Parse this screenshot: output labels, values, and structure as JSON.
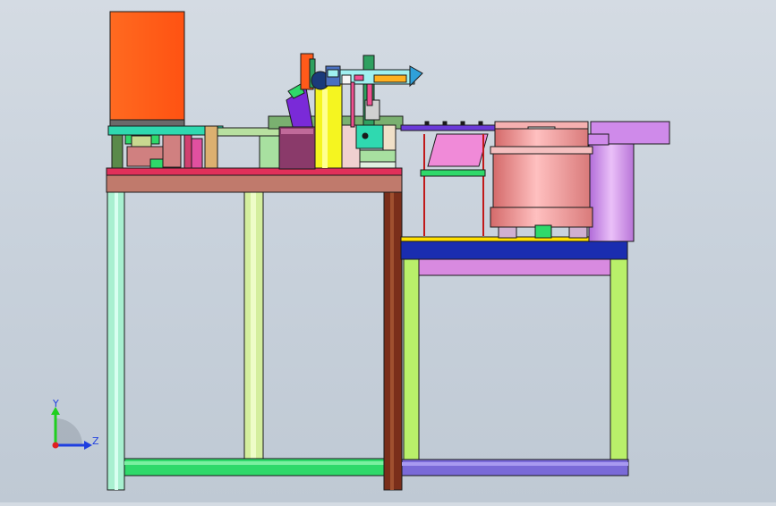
{
  "scene": {
    "background_top": "#d4dbe3",
    "background_bottom": "#bfc9d4",
    "outline_color": "#1a1a1a"
  },
  "triad": {
    "axis_y_label": "Y",
    "axis_z_label": "Z",
    "y_color": "#1fcf1f",
    "z_color": "#1f3fe0",
    "origin_color": "#e01f1f"
  },
  "parts": {
    "orange_housing": "#ff5a1a",
    "table_top": "#c07a6c",
    "left_leg": "#a8f0d0",
    "mid_leg": "#d4ee9e",
    "right_leg": "#7a2e1a",
    "bottom_rail_left": "#2fd96a",
    "right_table_top": "#1a2db0",
    "right_table_stripe": "#ffe000",
    "right_table_skirt": "#d88ae0",
    "right_legs": "#b9f06a",
    "bottom_rail_right": "#7a6ad8",
    "bowl_body": "#f5a0a0",
    "bowl_tower": "#cf8aea",
    "chute": "#f08ad8",
    "press_block": "#8a3a6a",
    "yellow_column": "#f5f520",
    "purple_slider": "#7a2ad8",
    "cyan_rail": "#a0f0f0",
    "teal_block": "#2fd9b0",
    "dark_block": "#1a3a7a"
  }
}
